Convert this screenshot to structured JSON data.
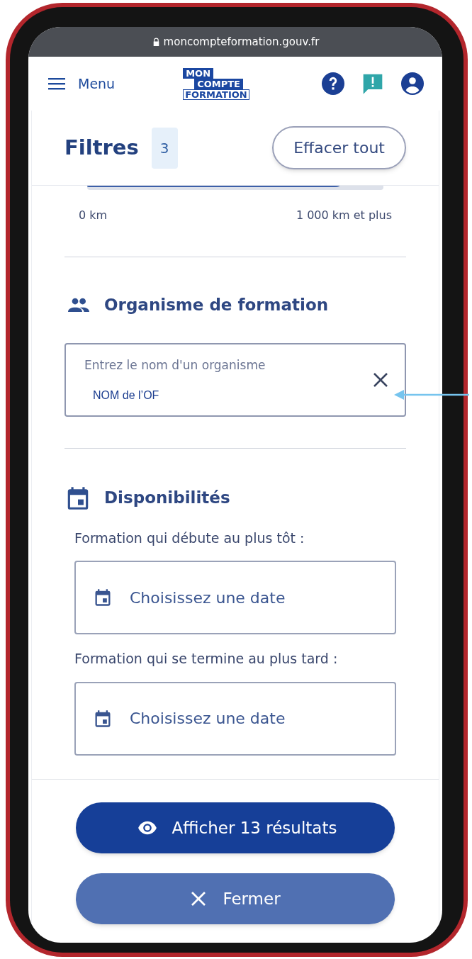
{
  "browser": {
    "url": "moncompteformation.gouv.fr"
  },
  "header": {
    "menu_label": "Menu",
    "logo": [
      "MON",
      "COMPTE",
      "FORMATION"
    ]
  },
  "filters": {
    "title": "Filtres",
    "count": "3",
    "clear_button": "Effacer tout"
  },
  "distance": {
    "level": 0.84,
    "min_label": "0 km",
    "max_label": "1 000 km et plus"
  },
  "organisme": {
    "title": "Organisme de formation",
    "field": {
      "label": "Entrez le nom d'un organisme",
      "value": "NOM de l’OF"
    }
  },
  "disponibilites": {
    "title": "Disponibilités",
    "fields": [
      {
        "label": "Formation qui débute au plus tôt :",
        "placeholder": "Choisissez une date"
      },
      {
        "label": "Formation qui se termine au plus tard :",
        "placeholder": "Choisissez une date"
      }
    ]
  },
  "actions": {
    "primary": "Afficher 13 résultats",
    "secondary": "Fermer"
  }
}
